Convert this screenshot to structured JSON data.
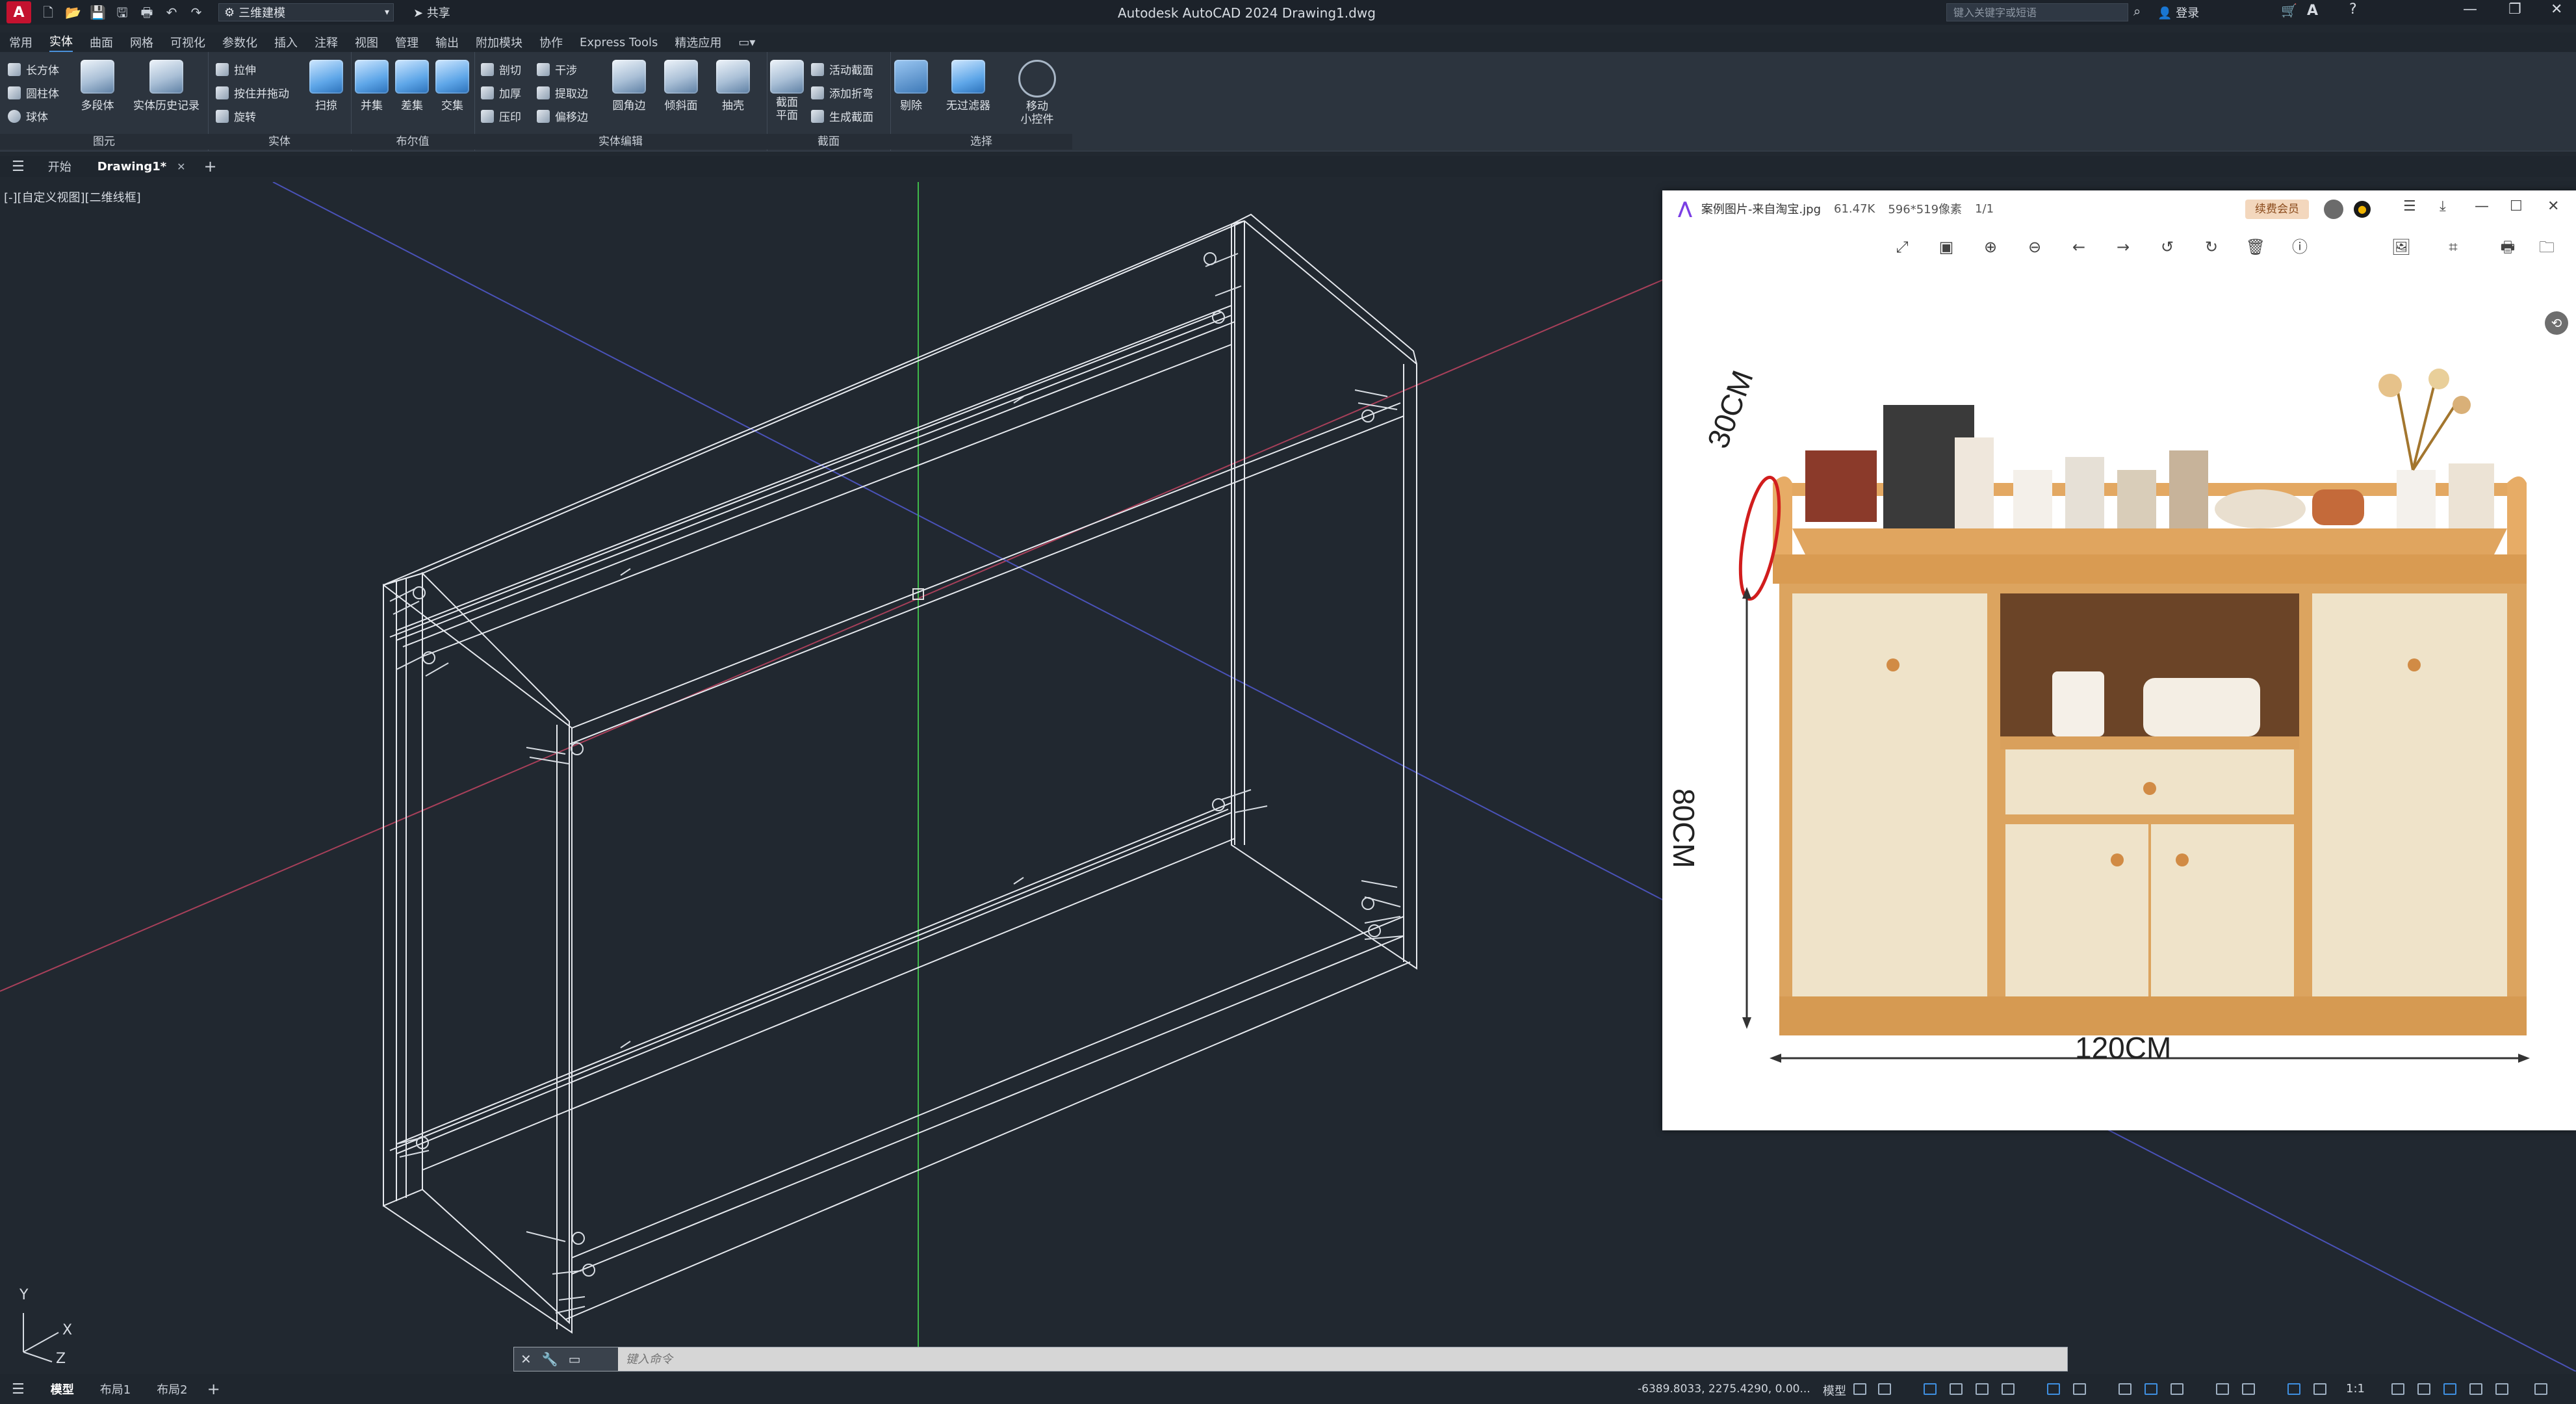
{
  "window": {
    "title": "Autodesk AutoCAD 2024   Drawing1.dwg",
    "workspace": "三维建模",
    "share_label": "共享",
    "search_placeholder": "键入关键字或短语",
    "login_label": "登录"
  },
  "menu": {
    "tabs": [
      "常用",
      "实体",
      "曲面",
      "网格",
      "可视化",
      "参数化",
      "插入",
      "注释",
      "视图",
      "管理",
      "输出",
      "附加模块",
      "协作",
      "Express Tools",
      "精选应用"
    ],
    "active": "实体"
  },
  "ribbon": {
    "primitive": {
      "title": "图元",
      "small": [
        "长方体",
        "圆柱体",
        "球体"
      ],
      "big": [
        "多段体"
      ]
    },
    "solid": {
      "title": "实体",
      "big": [
        "实体历史记录"
      ],
      "small": [
        "拉伸",
        "按住并拖动",
        "旋转"
      ],
      "sweep": "扫掠"
    },
    "boolean": {
      "title": "布尔值",
      "big": [
        "并集",
        "差集",
        "交集"
      ]
    },
    "solid_edit": {
      "title": "实体编辑",
      "small": [
        "剖切",
        "加厚",
        "压印",
        "干涉",
        "提取边",
        "偏移边"
      ],
      "big": [
        "圆角边",
        "倾斜面",
        "抽壳"
      ]
    },
    "section": {
      "title": "截面",
      "big1": "截面",
      "big1b": "平面",
      "small": [
        "活动截面",
        "添加折弯",
        "生成截面"
      ]
    },
    "selection": {
      "title": "选择",
      "big": [
        "剔除",
        "无过滤器"
      ],
      "move": "移动",
      "move2": "小控件"
    }
  },
  "filetabs": {
    "start": "开始",
    "drawing": "Drawing1*"
  },
  "viewport": {
    "label": "[-][自定义视图][二维线框]",
    "ucs": {
      "x": "X",
      "y": "Y",
      "z": "Z"
    }
  },
  "cmdline": {
    "placeholder": "键入命令"
  },
  "statusbar": {
    "tabs": [
      "模型",
      "布局1",
      "布局2"
    ],
    "coords": "-6389.8033, 2275.4290, 0.00...",
    "model": "模型",
    "scale": "1:1"
  },
  "viewer": {
    "filename": "案例图片-来自淘宝.jpg",
    "filesize": "61.47K",
    "dimensions": "596*519像素",
    "page": "1/1",
    "vip": "续费会员",
    "dims": {
      "depth": "30CM",
      "height": "80CM",
      "width": "120CM"
    }
  }
}
